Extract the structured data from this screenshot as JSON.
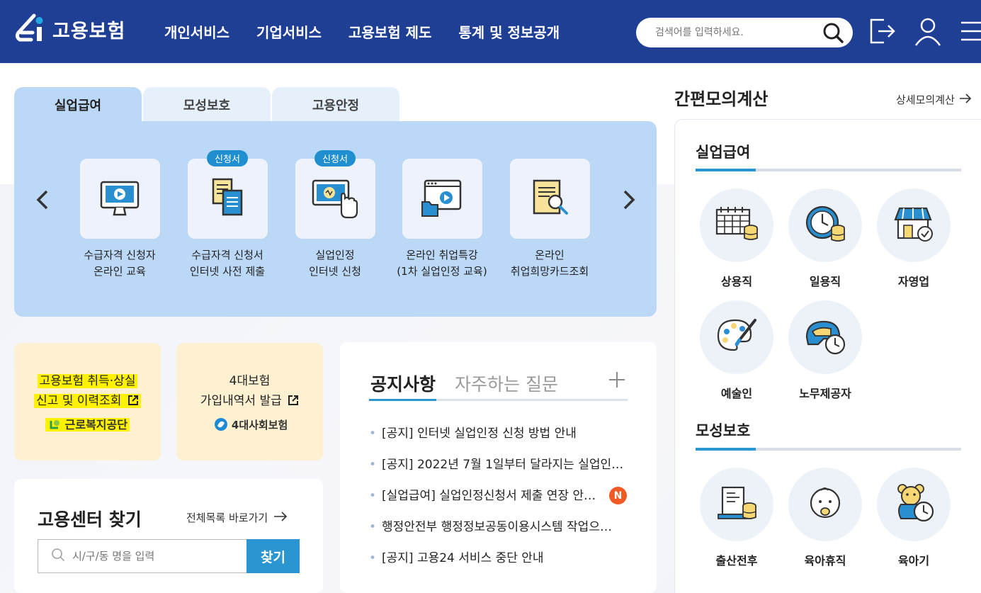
{
  "header": {
    "logo_text": "고용보험",
    "nav": [
      "개인서비스",
      "기업서비스",
      "고용보험 제도",
      "통계 및 정보공개"
    ],
    "search_placeholder": "검색어를 입력하세요."
  },
  "tabs": [
    {
      "label": "실업급여",
      "active": true
    },
    {
      "label": "모성보호",
      "active": false
    },
    {
      "label": "고용안정",
      "active": false
    }
  ],
  "services": [
    {
      "badge": "",
      "line1": "수급자격 신청자",
      "line2": "온라인 교육",
      "icon": "monitor-play-icon"
    },
    {
      "badge": "신청서",
      "line1": "수급자격 신청서",
      "line2": "인터넷 사전 제출",
      "icon": "document-copy-icon"
    },
    {
      "badge": "신청서",
      "line1": "실업인정",
      "line2": "인터넷 신청",
      "icon": "online-apply-icon"
    },
    {
      "badge": "",
      "line1": "온라인 취업특강",
      "line2": "(1차 실업인정 교육)",
      "icon": "video-folder-icon"
    },
    {
      "badge": "",
      "line1": "온라인",
      "line2": "취업희망카드조회",
      "icon": "card-search-icon"
    }
  ],
  "quick": {
    "card1": {
      "line1": "고용보험 취득·상실",
      "line2": "신고 및 이력조회",
      "org": "근로복지공단"
    },
    "card2": {
      "line1": "4대보험",
      "line2": "가입내역서 발급",
      "org": "4대사회보험"
    }
  },
  "notice": {
    "tab_active": "공지사항",
    "tab_inactive": "자주하는 질문",
    "items": [
      "[공지] 인터넷 실업인정 신청 방법 안내",
      "[공지] 2022년 7월 1일부터 달라지는 실업인…",
      "[실업급여] 실업인정신청서 제출 연장 안…",
      "행정안전부 행정정보공동이용시스템 작업으…",
      "[공지] 고용24 서비스 중단 안내"
    ],
    "new_badge": "N"
  },
  "finder": {
    "title": "고용센터 찾기",
    "link": "전체목록 바로가기",
    "placeholder": "시/구/동 명을 입력",
    "button": "찾기"
  },
  "calc": {
    "title": "간편모의계산",
    "link": "상세모의계산",
    "sections": [
      {
        "title": "실업급여",
        "items": [
          "상용직",
          "일용직",
          "자영업",
          "예술인",
          "노무제공자"
        ]
      },
      {
        "title": "모성보호",
        "items": [
          "출산전후",
          "육아휴직",
          "육아기"
        ]
      }
    ]
  },
  "colors": {
    "header_bg": "#1f3f95",
    "panel_bg": "#bcd8f7",
    "accent": "#2a95d0",
    "card_bg": "#fdf1d2",
    "highlight": "#fff200"
  }
}
